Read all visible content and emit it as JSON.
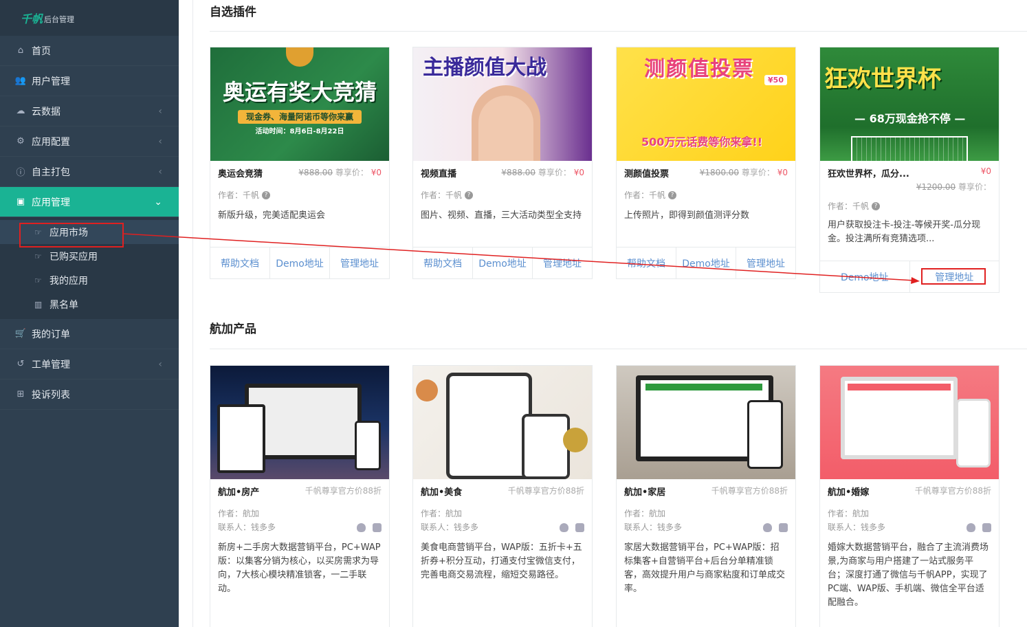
{
  "sidebar": {
    "logo_main": "千帆",
    "logo_sub": "后台管理",
    "items": [
      {
        "label": "首页",
        "icon": "home-icon"
      },
      {
        "label": "用户管理",
        "icon": "users-icon"
      },
      {
        "label": "云数据",
        "icon": "cloud-icon"
      },
      {
        "label": "应用配置",
        "icon": "gears-icon"
      },
      {
        "label": "自主打包",
        "icon": "info-icon"
      },
      {
        "label": "应用管理",
        "icon": "app-icon"
      },
      {
        "label": "我的订单",
        "icon": "cart-icon"
      },
      {
        "label": "工单管理",
        "icon": "history-icon"
      },
      {
        "label": "投诉列表",
        "icon": "plus-square-icon"
      }
    ],
    "sub_items": [
      {
        "label": "应用市场"
      },
      {
        "label": "已购买应用"
      },
      {
        "label": "我的应用"
      },
      {
        "label": "黑名单"
      }
    ]
  },
  "sections": {
    "plugins_title": "自选插件",
    "products_title": "航加产品"
  },
  "plugins": [
    {
      "img_text": "奥运有奖大竞猜",
      "img_sub": "现金券、海量阿诺币等你来赢",
      "img_note": "活动时间：8月6日-8月22日",
      "name": "奥运会竞猜",
      "old_price": "¥888.00",
      "vip": "尊享价：",
      "price": "¥0",
      "author": "作者：千帆",
      "desc": "新版升级，完美适配奥运会",
      "btn_help": "帮助文档",
      "btn_demo": "Demo地址",
      "btn_manage": "管理地址"
    },
    {
      "img_text": "主播颜值大战",
      "name": "视频直播",
      "old_price": "¥888.00",
      "vip": "尊享价：",
      "price": "¥0",
      "author": "作者：千帆",
      "desc": "图片、视频、直播，三大活动类型全支持",
      "btn_help": "帮助文档",
      "btn_demo": "Demo地址",
      "btn_manage": "管理地址"
    },
    {
      "img_text": "测颜值投票",
      "img_sub": "500万元话费等你来拿!!",
      "img_badge": "¥50",
      "name": "测颜值投票",
      "old_price": "¥1800.00",
      "vip": "尊享价：",
      "price": "¥0",
      "author": "作者：千帆",
      "desc": "上传照片，即得到颜值测评分数",
      "btn_help": "帮助文档",
      "btn_demo": "Demo地址",
      "btn_manage": "管理地址"
    },
    {
      "img_text": "狂欢世界杯",
      "img_sub": "— 68万现金抢不停 —",
      "name": "狂欢世界杯，瓜分...",
      "old_price": "¥1200.00",
      "vip": "尊享价：",
      "price": "¥0",
      "author": "作者：千帆",
      "desc": "用户获取投注卡-投注-等候开奖-瓜分现金。投注满所有竞猜选项...",
      "btn_demo": "Demo地址",
      "btn_manage": "管理地址"
    }
  ],
  "products": [
    {
      "name": "航加•房产",
      "discount": "千帆尊享官方价88折",
      "author": "作者：航加",
      "contact": "联系人：钱多多",
      "desc": "新房+二手房大数据营销平台，PC+WAP版：以集客分销为核心，以买房需求为导向，7大核心模块精准锁客，一二手联动。"
    },
    {
      "name": "航加•美食",
      "discount": "千帆尊享官方价88折",
      "author": "作者：航加",
      "contact": "联系人：钱多多",
      "desc": "美食电商营销平台，WAP版：五折卡+五折券+积分互动，打通支付宝微信支付，完善电商交易流程，缩短交易路径。"
    },
    {
      "name": "航加•家居",
      "discount": "千帆尊享官方价88折",
      "author": "作者：航加",
      "contact": "联系人：钱多多",
      "desc": "家居大数据营销平台，PC+WAP版：招标集客+自营销平台+后台分单精准锁客，高效提升用户与商家粘度和订单成交率。"
    },
    {
      "name": "航加•婚嫁",
      "discount": "千帆尊享官方价88折",
      "author": "作者：航加",
      "contact": "联系人：钱多多",
      "desc": "婚嫁大数据营销平台，融合了主流消费场景,为商家与用户搭建了一站式服务平台；深度打通了微信与千帆APP，实现了PC端、WAP版、手机端、微信全平台适配融合。"
    }
  ],
  "colors": {
    "accent": "#1ab394",
    "sidebar": "#2f4050",
    "link": "#5b8fcf",
    "price_red": "#ed5565",
    "annotation_red": "#e02020"
  }
}
